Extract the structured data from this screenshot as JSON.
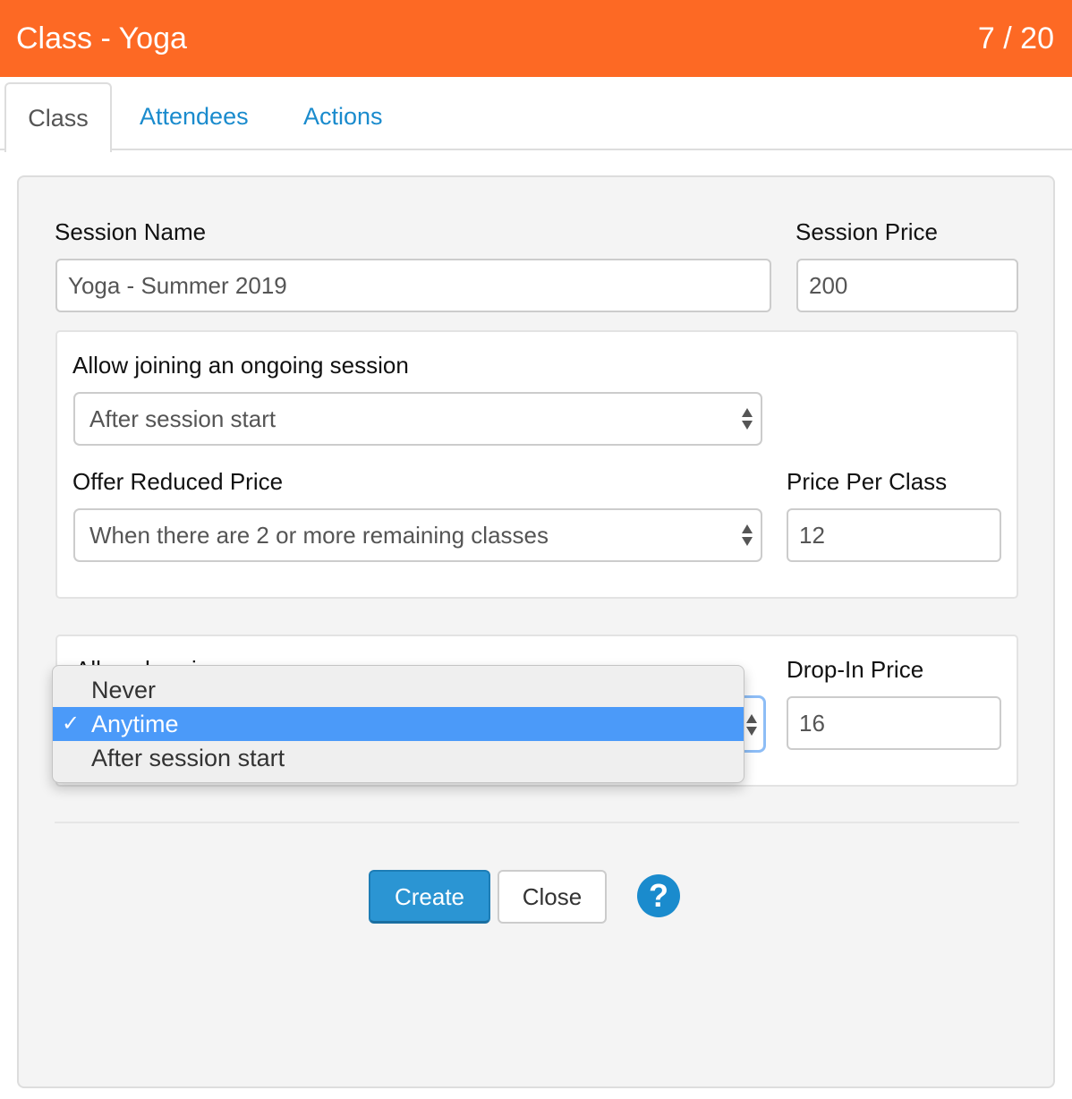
{
  "header": {
    "title": "Class - Yoga",
    "counter": "7 / 20",
    "color": "#fd6924"
  },
  "tabs": [
    {
      "label": "Class",
      "active": true
    },
    {
      "label": "Attendees",
      "active": false
    },
    {
      "label": "Actions",
      "active": false
    }
  ],
  "form": {
    "session_name": {
      "label": "Session Name",
      "value": "Yoga - Summer 2019"
    },
    "session_price": {
      "label": "Session Price",
      "value": "200"
    },
    "allow_joining": {
      "label": "Allow joining an ongoing session",
      "value": "After session start"
    },
    "reduced_price": {
      "label": "Offer Reduced Price",
      "value": "When there are 2 or more remaining classes"
    },
    "price_per_class": {
      "label": "Price Per Class",
      "value": "12"
    },
    "allow_drop_ins": {
      "label": "Allow drop-ins",
      "options": [
        "Never",
        "Anytime",
        "After session start"
      ],
      "selected": "Anytime",
      "check_glyph": "✓"
    },
    "drop_in_price": {
      "label": "Drop-In Price",
      "value": "16"
    }
  },
  "buttons": {
    "create": "Create",
    "close": "Close",
    "help": "?"
  },
  "colors": {
    "accent": "#1a8bcd",
    "primary_button": "#2b95d3",
    "selected_option": "#4b9af9"
  }
}
